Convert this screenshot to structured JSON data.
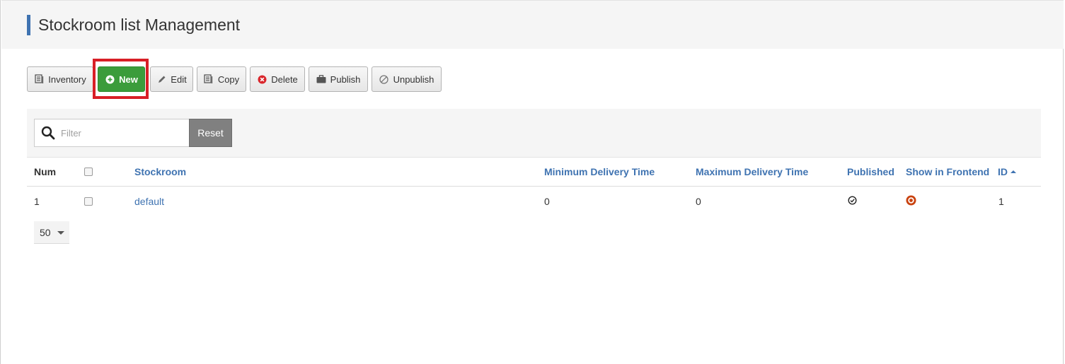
{
  "page": {
    "title": "Stockroom list Management"
  },
  "toolbar": {
    "inventory": "Inventory",
    "new": "New",
    "edit": "Edit",
    "copy": "Copy",
    "delete": "Delete",
    "publish": "Publish",
    "unpublish": "Unpublish"
  },
  "filter": {
    "placeholder": "Filter",
    "reset": "Reset"
  },
  "table": {
    "headers": {
      "num": "Num",
      "stockroom": "Stockroom",
      "min_delivery": "Minimum Delivery Time",
      "max_delivery": "Maximum Delivery Time",
      "published": "Published",
      "show_frontend": "Show in Frontend",
      "id": "ID"
    },
    "rows": [
      {
        "num": "1",
        "stockroom": "default",
        "min_delivery": "0",
        "max_delivery": "0",
        "published": true,
        "show_frontend": true,
        "id": "1"
      }
    ]
  },
  "pagination": {
    "limit": "50"
  },
  "colors": {
    "accent": "#3f73b1",
    "new_button": "#3b9c3b",
    "highlight": "#d81f26",
    "frontend_icon": "#c9420f"
  }
}
